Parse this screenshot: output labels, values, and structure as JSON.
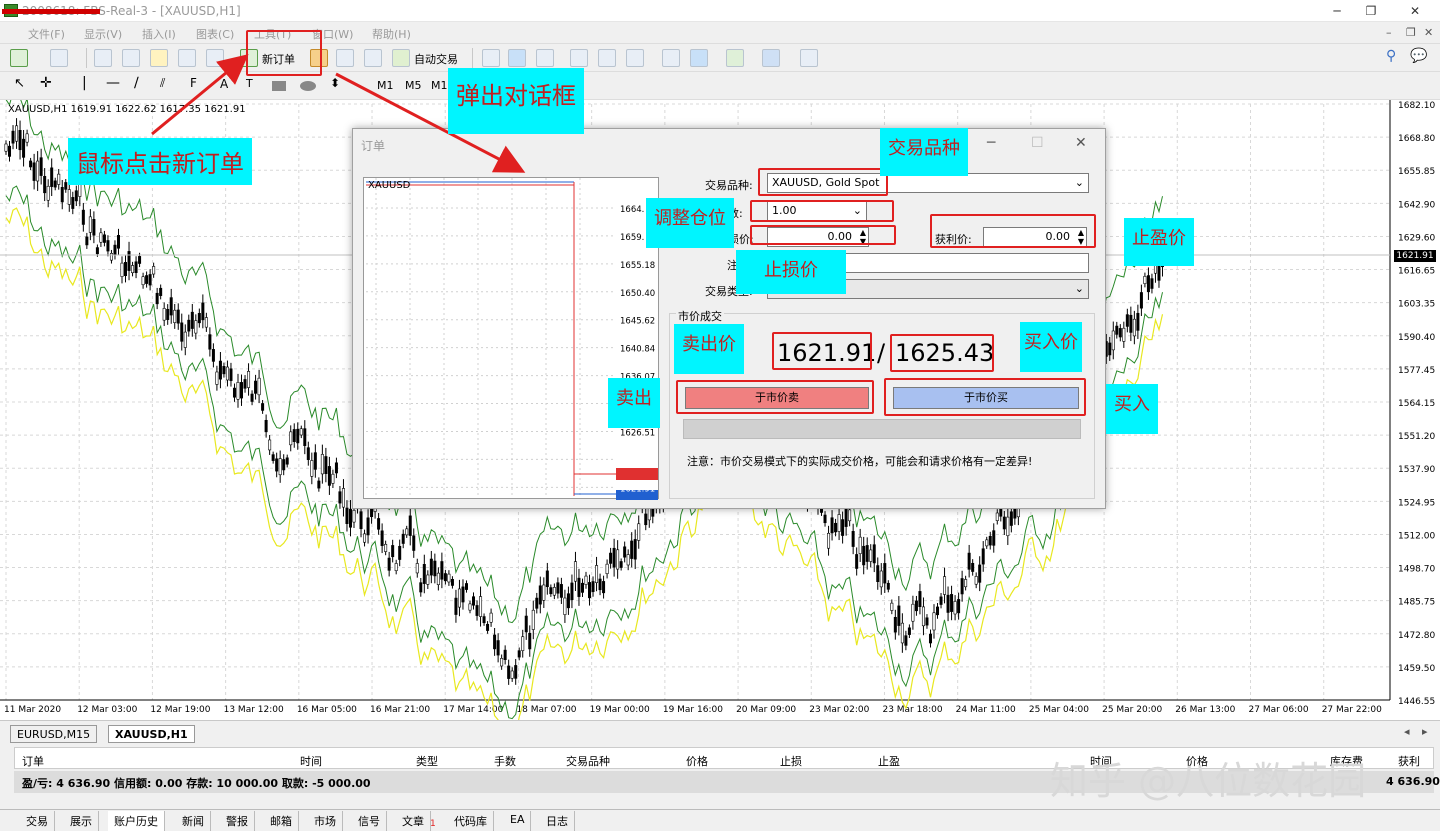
{
  "window": {
    "title": "2008618: FBS-Real-3 - [XAUUSD,H1]",
    "controls": [
      "─",
      "❐",
      "✕"
    ]
  },
  "menu": [
    "文件(F)",
    "显示(V)",
    "插入(I)",
    "图表(C)",
    "工具(T)",
    "窗口(W)",
    "帮助(H)"
  ],
  "toolbar": {
    "new_order": "新订单",
    "auto_trade": "自动交易"
  },
  "timeframes": [
    "M1",
    "M5",
    "M15"
  ],
  "chart": {
    "info": "XAUUSD,H1  1619.91 1622.62 1617.35 1621.91",
    "last_price": "1621.91",
    "price_axis": [
      "1682.10",
      "1668.80",
      "1655.85",
      "1642.90",
      "1629.60",
      "1616.65",
      "1603.35",
      "1590.40",
      "1577.45",
      "1564.15",
      "1551.20",
      "1537.90",
      "1524.95",
      "1512.00",
      "1498.70",
      "1485.75",
      "1472.80",
      "1459.50",
      "1446.55"
    ],
    "time_axis": [
      "11 Mar 2020",
      "12 Mar 03:00",
      "12 Mar 19:00",
      "13 Mar 12:00",
      "16 Mar 05:00",
      "16 Mar 21:00",
      "17 Mar 14:00",
      "18 Mar 07:00",
      "19 Mar 00:00",
      "19 Mar 16:00",
      "20 Mar 09:00",
      "23 Mar 02:00",
      "23 Mar 18:00",
      "24 Mar 11:00",
      "25 Mar 04:00",
      "25 Mar 20:00",
      "26 Mar 13:00",
      "27 Mar 06:00",
      "27 Mar 22:00"
    ]
  },
  "dialog": {
    "title": "订单",
    "mini_symbol": "XAUUSD",
    "mini_axis": [
      "1664.",
      "1659.",
      "1655.18",
      "1650.40",
      "1645.62",
      "1640.84",
      "1636.07",
      "1631.29",
      "1626.51",
      "1625.43",
      "1621.91"
    ],
    "symbol_label": "交易品种:",
    "symbol_value": "XAUUSD, Gold Spot",
    "lots_label": "手数:",
    "lots_value": "1.00",
    "sl_label": "止损价:",
    "sl_value": "0.00",
    "tp_label": "获利价:",
    "tp_value": "0.00",
    "comment_label": "注释:",
    "type_label": "交易类型:",
    "market_label": "市价成交",
    "bid": "1621.91",
    "slash": "/",
    "ask": "1625.43",
    "sell_btn": "于市价卖",
    "buy_btn": "于市价买",
    "note": "注意：市价交易模式下的实际成交价格，可能会和请求价格有一定差异!"
  },
  "annotations": {
    "click": "鼠标点击新订单",
    "popup": "弹出对话框",
    "symbol": "交易品种",
    "lots": "调整仓位",
    "tp": "止盈价",
    "sl": "止损价",
    "sell_price": "卖出价",
    "buy_price": "买入价",
    "sell": "卖出",
    "buy": "买入"
  },
  "chart_tabs": [
    "EURUSD,M15",
    "XAUUSD,H1"
  ],
  "terminal": {
    "headers": [
      "订单",
      "时间",
      "类型",
      "手数",
      "交易品种",
      "价格",
      "止损",
      "止盈",
      "时间",
      "价格",
      "库存费",
      "获利"
    ],
    "summary": "盈/亏: 4 636.90  信用额: 0.00  存款: 10 000.00  取款: -5 000.00",
    "profit": "4 636.90",
    "tabs": [
      "交易",
      "展示",
      "账户历史",
      "新闻",
      "警报",
      "邮箱",
      "市场",
      "信号",
      "文章",
      "代码库",
      "EA",
      "日志"
    ],
    "article_badge": "1"
  },
  "watermark": "知乎 @八位数花园",
  "colors": {
    "annotation_bg": "#00f5ff",
    "annotation_text": "#c02020",
    "sell_btn": "#f08080",
    "buy_btn": "#a8c0f0",
    "highlight": "#e02020"
  }
}
